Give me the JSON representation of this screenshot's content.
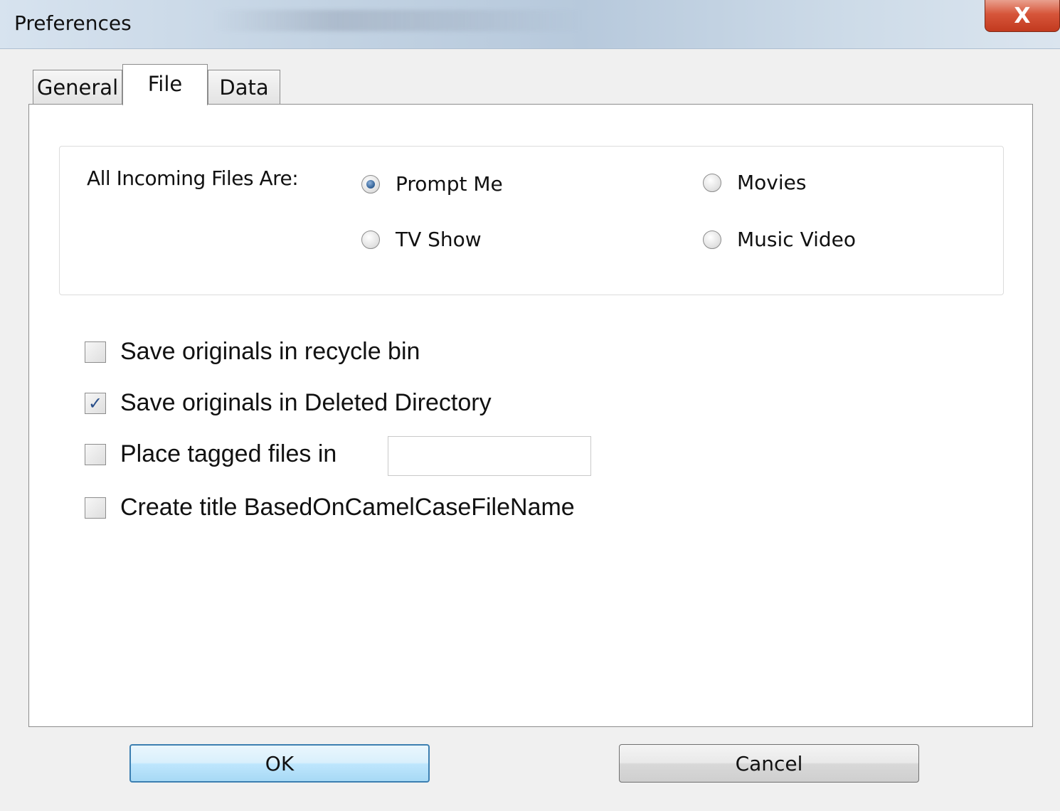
{
  "window": {
    "title": "Preferences",
    "close_glyph": "X"
  },
  "tabs": [
    {
      "label": "General",
      "active": false
    },
    {
      "label": "File",
      "active": true
    },
    {
      "label": "Data",
      "active": false
    }
  ],
  "incoming": {
    "label": "All Incoming Files Are:",
    "options": [
      {
        "label": "Prompt Me",
        "selected": true
      },
      {
        "label": "Movies",
        "selected": false
      },
      {
        "label": "TV Show",
        "selected": false
      },
      {
        "label": "Music Video",
        "selected": false
      }
    ]
  },
  "options": [
    {
      "label": "Save originals in recycle bin",
      "checked": false
    },
    {
      "label": "Save originals in Deleted Directory",
      "checked": true
    },
    {
      "label": "Place tagged files in",
      "checked": false
    },
    {
      "label": "Create title BasedOnCamelCaseFileName",
      "checked": false
    }
  ],
  "tagged_folder": {
    "value": ""
  },
  "buttons": {
    "ok": "OK",
    "cancel": "Cancel"
  },
  "colors": {
    "accent": "#3c7fb1",
    "close": "#c23a1f"
  },
  "icons": {
    "close": "close-icon",
    "checkmark": "checkmark-icon"
  }
}
